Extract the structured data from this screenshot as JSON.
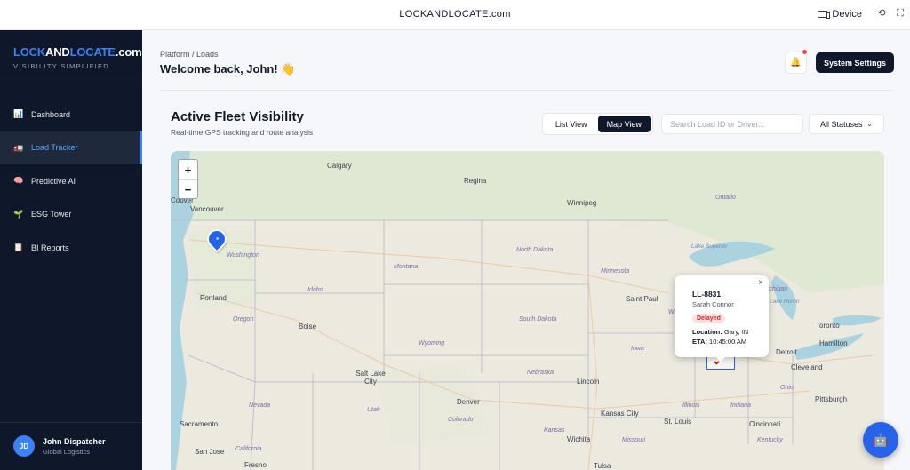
{
  "browser": {
    "url": "LOCKANDLOCATE.com",
    "device_label": "Device"
  },
  "sidebar": {
    "logo_part1": "LOCK",
    "logo_part2": "AND",
    "logo_part3": "LOCATE",
    "logo_part4": ".com",
    "tagline": "VISIBILITY SIMPLIFIED",
    "items": [
      {
        "label": "Dashboard",
        "icon": "📊",
        "icon_name": "bar-chart-icon",
        "active": false
      },
      {
        "label": "Load Tracker",
        "icon": "🚛",
        "icon_name": "truck-icon",
        "active": true
      },
      {
        "label": "Predictive AI",
        "icon": "🧠",
        "icon_name": "brain-icon",
        "active": false
      },
      {
        "label": "ESG Tower",
        "icon": "🌱",
        "icon_name": "seedling-icon",
        "active": false
      },
      {
        "label": "BI Reports",
        "icon": "📋",
        "icon_name": "clipboard-icon",
        "active": false
      }
    ],
    "user": {
      "initials": "JD",
      "name": "John Dispatcher",
      "role": "Global Logistics"
    }
  },
  "header": {
    "breadcrumb": "Platform / Loads",
    "welcome": "Welcome back, John! 👋",
    "settings_button": "System Settings"
  },
  "fleet": {
    "title": "Active Fleet Visibility",
    "subtitle": "Real-time GPS tracking and route analysis",
    "view_list": "List View",
    "view_map": "Map View",
    "active_view": "Map View",
    "search_placeholder": "Search Load ID or Driver...",
    "status_filter": "All Statuses"
  },
  "map": {
    "zoom_in": "+",
    "zoom_out": "−",
    "cities": [
      "Calgary",
      "Regina",
      "Winnipeg",
      "Vancouver",
      "Portland",
      "Boise",
      "Salt Lake City",
      "Denver",
      "Lincoln",
      "Kansas City",
      "Wichita",
      "Saint Paul",
      "Detroit",
      "Toronto",
      "Hamilton",
      "Cleveland",
      "Pittsburgh",
      "Cincinnati",
      "St. Louis",
      "Sacramento",
      "San Jose",
      "Fresno",
      "Tulsa",
      "Couver"
    ],
    "states": [
      "Washington",
      "Montana",
      "North Dakota",
      "Minnesota",
      "South Dakota",
      "Idaho",
      "Oregon",
      "Wyoming",
      "Nebraska",
      "Iowa",
      "Utah",
      "Colorado",
      "Kansas",
      "Illinois",
      "Indiana",
      "Ohio",
      "Missouri",
      "Nevada",
      "California",
      "Ontario",
      "Michigan",
      "Wisconsin",
      "Kentucky"
    ],
    "water": [
      "Lake Superior",
      "Lake Huron"
    ]
  },
  "popup": {
    "load_id": "LL-8831",
    "driver": "Sarah Connor",
    "status": "Delayed",
    "location_label": "Location:",
    "location": "Gary, IN",
    "eta_label": "ETA:",
    "eta": "10:45:00 AM",
    "close": "×"
  },
  "colors": {
    "sidebar_bg": "#0f172a",
    "accent": "#3b82f6",
    "delayed": "#dc2626"
  }
}
